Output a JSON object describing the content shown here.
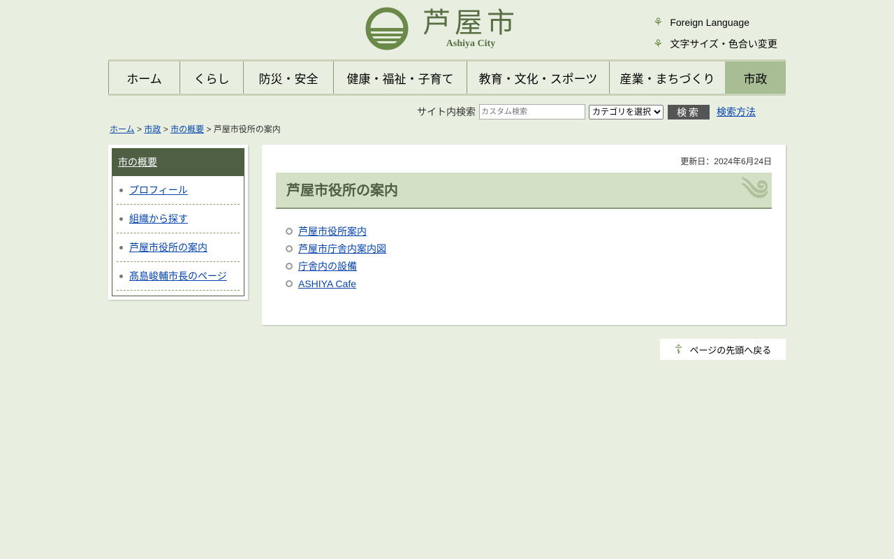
{
  "header": {
    "logo_jp": "芦屋市",
    "logo_en": "Ashiya City",
    "links": [
      "Foreign Language",
      "文字サイズ・色合い変更"
    ]
  },
  "nav": [
    {
      "label": "ホーム"
    },
    {
      "label": "くらし"
    },
    {
      "label": "防災・安全"
    },
    {
      "label": "健康・福祉・子育て"
    },
    {
      "label": "教育・文化・スポーツ"
    },
    {
      "label": "産業・まちづくり"
    },
    {
      "label": "市政"
    }
  ],
  "search": {
    "label": "サイト内検索",
    "placeholder": "カスタム検索",
    "category": "カテゴリを選択",
    "button": "検索",
    "help": "検索方法"
  },
  "breadcrumb": {
    "items": [
      "ホーム",
      "市政",
      "市の概要"
    ],
    "current": "芦屋市役所の案内",
    "sep": ">"
  },
  "sidebar": {
    "heading": "市の概要",
    "items": [
      "プロフィール",
      "組織から探す",
      "芦屋市役所の案内",
      "髙島峻輔市長のページ"
    ]
  },
  "main": {
    "updated": "更新日：2024年6月24日",
    "title": "芦屋市役所の案内",
    "links": [
      "芦屋市役所案内",
      "芦屋市庁舎内案内図",
      "庁舎内の設備",
      "ASHIYA Cafe"
    ]
  },
  "pagetop": "ページの先頭へ戻る"
}
